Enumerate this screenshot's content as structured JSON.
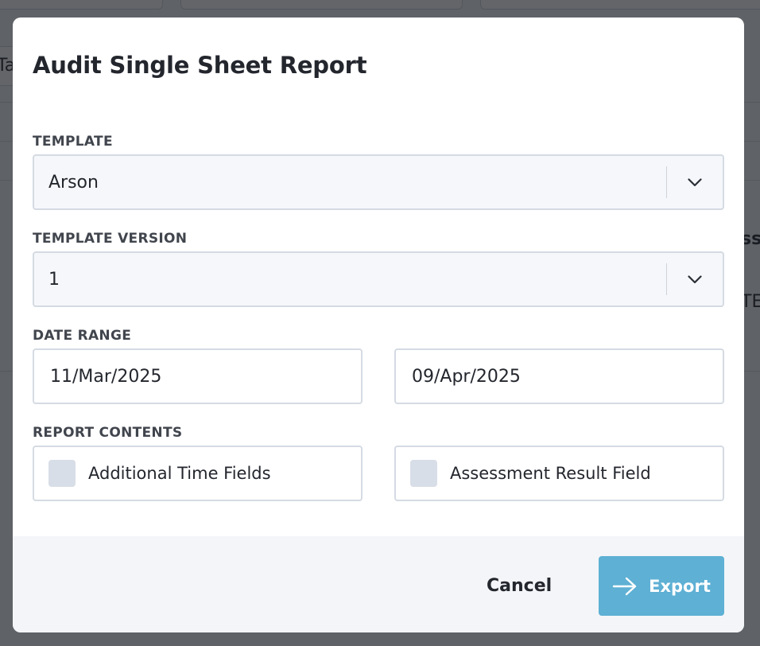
{
  "background": {
    "fragment_left": "Ta",
    "fragment_right_1": "ss",
    "fragment_right_2": "TE"
  },
  "modal": {
    "title": "Audit Single Sheet Report",
    "template": {
      "label": "TEMPLATE",
      "value": "Arson",
      "icon": "chevron-down-icon"
    },
    "template_version": {
      "label": "TEMPLATE VERSION",
      "value": "1",
      "icon": "chevron-down-icon"
    },
    "date_range": {
      "label": "DATE RANGE",
      "start": "11/Mar/2025",
      "end": "09/Apr/2025"
    },
    "report_contents": {
      "label": "REPORT CONTENTS",
      "options": [
        {
          "label": "Additional Time Fields",
          "checked": false
        },
        {
          "label": "Assessment Result Field",
          "checked": false
        }
      ]
    },
    "footer": {
      "cancel_label": "Cancel",
      "export_label": "Export",
      "export_icon": "arrow-right-icon"
    }
  },
  "colors": {
    "accent": "#5eb0d4",
    "checkbox_fill": "#d8dee7",
    "field_border": "#d5dbe3",
    "footer_bg": "#f4f5f8",
    "text": "#23262d"
  }
}
